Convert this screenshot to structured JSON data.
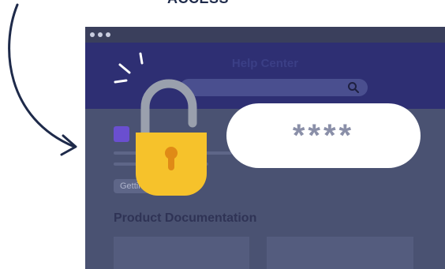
{
  "top_word": "ACCESS",
  "header": {
    "title": "Help Center"
  },
  "search": {
    "icon": "search-icon"
  },
  "tag": {
    "label": "Getting"
  },
  "section": {
    "title": "Product Documentation"
  },
  "password": {
    "mask": "****"
  },
  "colors": {
    "header_bg": "#2e2f73",
    "window_bg": "#4a5272",
    "lock_body": "#f6c22b",
    "lock_shackle": "#9aa0ad",
    "keyhole": "#e08a16"
  },
  "icons": [
    "search-icon",
    "padlock-icon",
    "keyhole-icon",
    "curved-arrow-icon",
    "sparkle-icon"
  ]
}
